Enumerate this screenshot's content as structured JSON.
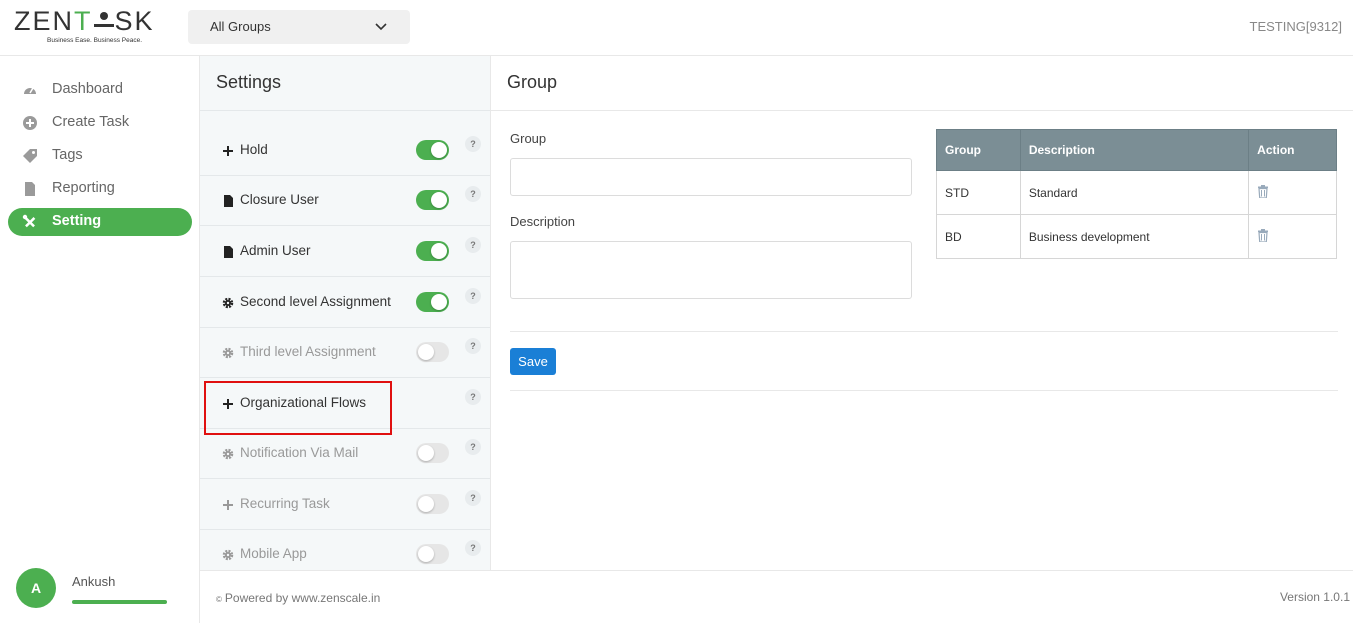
{
  "header": {
    "logo_text_a": "ZEN",
    "logo_text_b": "T",
    "logo_text_c": "SK",
    "logo_tagline": "Business Ease. Business Peace.",
    "group_select": {
      "value": "All Groups",
      "icon": "chevron-down-icon"
    },
    "account_label": "TESTING[9312]"
  },
  "nav": {
    "items": [
      {
        "label": "Dashboard",
        "icon": "dashboard-icon",
        "active": false
      },
      {
        "label": "Create Task",
        "icon": "plus-circle-icon",
        "active": false
      },
      {
        "label": "Tags",
        "icon": "tag-icon",
        "active": false
      },
      {
        "label": "Reporting",
        "icon": "document-icon",
        "active": false
      },
      {
        "label": "Setting",
        "icon": "tools-icon",
        "active": true
      }
    ],
    "user": {
      "initial": "A",
      "name": "Ankush"
    }
  },
  "settings": {
    "title": "Settings",
    "help_glyph": "?",
    "items": [
      {
        "label": "Hold",
        "icon": "plus-icon",
        "toggle": true,
        "enabled": true,
        "has_toggle": true
      },
      {
        "label": "Closure User",
        "icon": "file-icon",
        "toggle": true,
        "enabled": true,
        "has_toggle": true
      },
      {
        "label": "Admin User",
        "icon": "file-icon",
        "toggle": true,
        "enabled": true,
        "has_toggle": true
      },
      {
        "label": "Second level Assignment",
        "icon": "gear-icon",
        "toggle": true,
        "enabled": true,
        "has_toggle": true
      },
      {
        "label": "Third level Assignment",
        "icon": "gear-icon",
        "toggle": false,
        "enabled": false,
        "has_toggle": true
      },
      {
        "label": "Organizational Flows",
        "icon": "plus-icon",
        "toggle": false,
        "enabled": true,
        "has_toggle": false
      },
      {
        "label": "Notification Via Mail",
        "icon": "gear-icon",
        "toggle": false,
        "enabled": false,
        "has_toggle": true
      },
      {
        "label": "Recurring Task",
        "icon": "plus-icon",
        "toggle": false,
        "enabled": false,
        "has_toggle": true
      },
      {
        "label": "Mobile App",
        "icon": "gear-icon",
        "toggle": false,
        "enabled": false,
        "has_toggle": true
      }
    ]
  },
  "main": {
    "title": "Group",
    "form": {
      "group_label": "Group",
      "group_value": "",
      "description_label": "Description",
      "description_value": "",
      "save_label": "Save"
    },
    "table": {
      "headers": [
        "Group",
        "Description",
        "Action"
      ],
      "rows": [
        {
          "group": "STD",
          "description": "Standard",
          "action_icon": "trash-icon"
        },
        {
          "group": "BD",
          "description": "Business development",
          "action_icon": "trash-icon"
        }
      ]
    }
  },
  "footer": {
    "copyright_glyph": "©",
    "powered_by": "Powered by www.zenscale.in",
    "version": "Version 1.0.1"
  },
  "colors": {
    "brand_green": "#4caf50",
    "primary_blue": "#1a7fd6",
    "table_header": "#7b8e95",
    "highlight_red": "#e01010"
  }
}
